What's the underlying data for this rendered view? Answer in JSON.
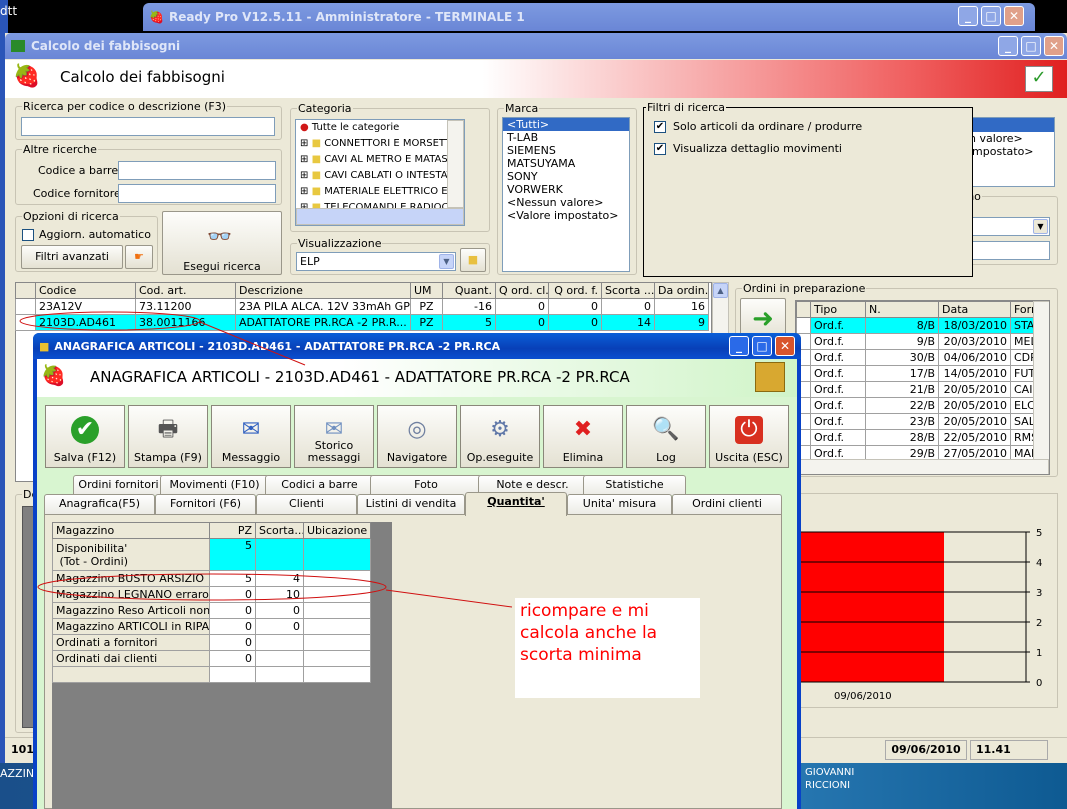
{
  "desktop": {
    "left_text": "dtt",
    "taskbar_left": "AZZINO",
    "taskbar_user_line1": "GIOVANNI",
    "taskbar_user_line2": "RICCIONI"
  },
  "app_window": {
    "title": "Ready Pro V12.5.11 - Amministratore - TERMINALE 1"
  },
  "main_window": {
    "title": "Calcolo dei fabbisogni",
    "header": "Calcolo dei fabbisogni",
    "search": {
      "legend": "Ricerca per codice o descrizione (F3)",
      "value": ""
    },
    "other": {
      "legend": "Altre ricerche",
      "barcode_label": "Codice a barre :",
      "supplier_label": "Codice fornitore :"
    },
    "options": {
      "legend": "Opzioni di ricerca",
      "auto_update": "Aggiorn. automatico",
      "advanced_filters": "Filtri avanzati"
    },
    "run_search": "Esegui ricerca",
    "category": {
      "legend": "Categoria",
      "items": [
        "Tutte le categorie",
        "CONNETTORI E MORSETTI",
        "CAVI AL METRO E MATASSE",
        "CAVI CABLATI O INTESTAT",
        "MATERIALE ELETTRICO E A",
        "TELECOMANDI E RADIOCO"
      ]
    },
    "view": {
      "legend": "Visualizzazione",
      "value": "ELP"
    },
    "brand": {
      "legend": "Marca",
      "items": [
        "<Tutti>",
        "T-LAB",
        "SIEMENS",
        "MATSUYAMA",
        "SONY",
        "VORWERK",
        "<Nessun valore>",
        "<Valore impostato>"
      ]
    },
    "filters": {
      "legend": "Filtri di ricerca",
      "only_to_order": "Solo articoli da ordinare / produrre",
      "show_movements": "Visualizza dettaglio movimenti"
    },
    "behind_list": [
      "n valore>",
      "impostato>"
    ],
    "listino_legend": "listino",
    "grid": {
      "headers": [
        "Codice",
        "Cod. art.",
        "Descrizione",
        "UM",
        "Quant.",
        "Q ord. cl.",
        "Q ord. f.",
        "Scorta ...",
        "Da ordin."
      ],
      "rows": [
        [
          "23A12V",
          "73.11200",
          "23A PILA ALCA. 12V 33mAh GP",
          "PZ",
          "-16",
          "0",
          "0",
          "0",
          "16"
        ],
        [
          "2103D.AD461",
          "38.0011166",
          "ADATTATORE PR.RCA -2 PR.R...",
          "PZ",
          "5",
          "0",
          "0",
          "14",
          "9"
        ]
      ]
    },
    "orders": {
      "legend": "Ordini in preparazione",
      "headers": [
        "Tipo",
        "N.",
        "Data",
        "Fornitore"
      ],
      "rows": [
        [
          "Ord.f.",
          "8/B",
          "18/03/2010",
          "STAB SF"
        ],
        [
          "Ord.f.",
          "9/B",
          "20/03/2010",
          "MELCHIC"
        ],
        [
          "Ord.f.",
          "30/B",
          "04/06/2010",
          "CDR INT"
        ],
        [
          "Ord.f.",
          "17/B",
          "14/05/2010",
          "FUTURA"
        ],
        [
          "Ord.f.",
          "21/B",
          "20/05/2010",
          "CAIROLI"
        ],
        [
          "Ord.f.",
          "22/B",
          "20/05/2010",
          "ELCART"
        ],
        [
          "Ord.f.",
          "23/B",
          "20/05/2010",
          "SALA CO"
        ],
        [
          "Ord.f.",
          "28/B",
          "22/05/2010",
          "RMS INT"
        ],
        [
          "Ord.f.",
          "29/B",
          "27/05/2010",
          "MARCUC"
        ]
      ]
    },
    "detail_legend": "De",
    "status": {
      "count": "101",
      "date": "09/06/2010",
      "time": "11.41"
    }
  },
  "chart_data": {
    "type": "bar",
    "categories": [
      "09/06/2010"
    ],
    "values": [
      5
    ],
    "ylim": [
      0,
      5
    ],
    "yticks": [
      "0",
      "1",
      "2",
      "3",
      "4",
      "5"
    ],
    "bar_color": "#ff0000",
    "grid": true
  },
  "dialog": {
    "title": "ANAGRAFICA ARTICOLI - 2103D.AD461 - ADATTATORE PR.RCA -2 PR.RCA",
    "header": "ANAGRAFICA ARTICOLI - 2103D.AD461 - ADATTATORE PR.RCA -2 PR.RCA",
    "toolbar": [
      {
        "label": "Salva (F12)",
        "icon": "check-icon"
      },
      {
        "label": "Stampa (F9)",
        "icon": "printer-icon"
      },
      {
        "label": "Messaggio",
        "icon": "envelope-pen-icon"
      },
      {
        "label": "Storico messaggi",
        "icon": "envelope-search-icon"
      },
      {
        "label": "Navigatore",
        "icon": "compass-icon"
      },
      {
        "label": "Op.eseguite",
        "icon": "gears-icon"
      },
      {
        "label": "Elimina",
        "icon": "delete-x-icon"
      },
      {
        "label": "Log",
        "icon": "log-search-icon"
      },
      {
        "label": "Uscita (ESC)",
        "icon": "power-icon"
      }
    ],
    "tabs_row1": [
      "Ordini fornitori",
      "Movimenti (F10)",
      "Codici a barre",
      "Foto",
      "Note e descr.",
      "Statistiche"
    ],
    "tabs_row2": [
      "Anagrafica(F5)",
      "Fornitori (F6)",
      "Clienti",
      "Listini di vendita",
      "Quantita'",
      "Unita' misura",
      "Ordini clienti"
    ],
    "active_tab": "Quantita'",
    "qty": {
      "headers": [
        "Magazzino",
        "PZ",
        "Scorta...",
        "Ubicazione"
      ],
      "rows": [
        [
          "Disponibilita'\n (Tot - Ordini)",
          "5",
          "",
          ""
        ],
        [
          "Magazzino BUSTO ARSIZIO",
          "5",
          "4",
          ""
        ],
        [
          "Magazzino LEGNANO erraro",
          "0",
          "10",
          ""
        ],
        [
          "Magazzino Reso Articoli non ...",
          "0",
          "0",
          ""
        ],
        [
          "Magazzino ARTICOLI in RIPA...",
          "0",
          "0",
          ""
        ],
        [
          "Ordinati a fornitori",
          "0",
          "",
          ""
        ],
        [
          "Ordinati dai clienti",
          "0",
          "",
          ""
        ],
        [
          "",
          "",
          "",
          ""
        ]
      ]
    }
  },
  "annotation": {
    "text": "ricompare e mi calcola anche la scorta minima",
    "color": "#ff0000"
  }
}
